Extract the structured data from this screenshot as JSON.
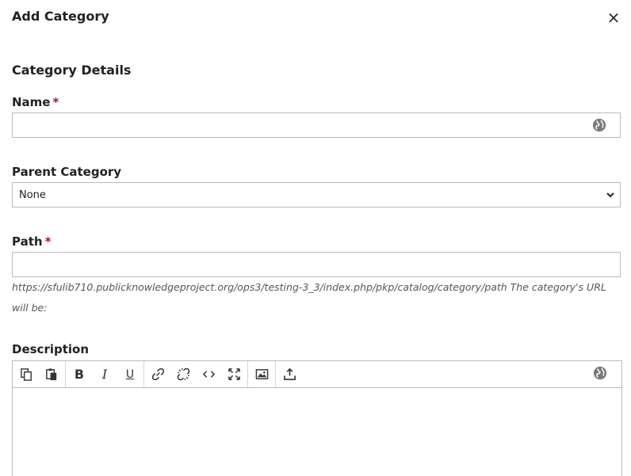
{
  "modal": {
    "title": "Add Category",
    "close_label": "×"
  },
  "section_title": "Category Details",
  "fields": {
    "name": {
      "label": "Name",
      "required_mark": "*",
      "value": ""
    },
    "parent_category": {
      "label": "Parent Category",
      "selected": "None"
    },
    "path": {
      "label": "Path",
      "required_mark": "*",
      "value": "",
      "help": "https://sfulib710.publicknowledgeproject.org/ops3/testing-3_3/index.php/pkp/catalog/category/path The category's URL will be:"
    },
    "description": {
      "label": "Description",
      "value": ""
    }
  },
  "toolbar": {
    "bold": "B",
    "italic": "I",
    "underline": "U"
  },
  "icons": {
    "globe": "globe-icon",
    "chevron": "chevron-down-icon"
  }
}
